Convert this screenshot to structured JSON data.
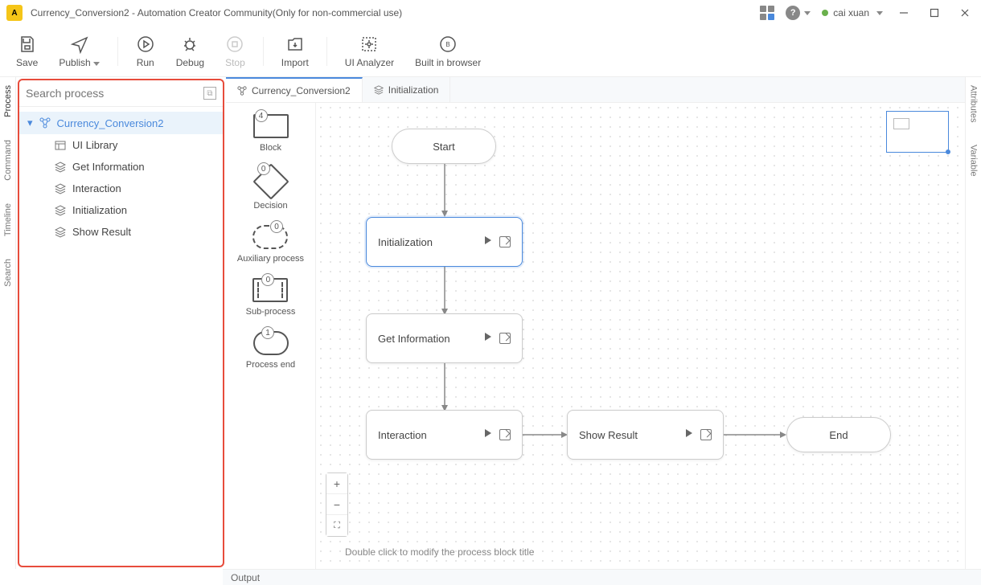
{
  "title": "Currency_Conversion2 - Automation Creator Community(Only for non-commercial use)",
  "user": "cai xuan",
  "toolbar": {
    "save": "Save",
    "publish": "Publish",
    "run": "Run",
    "debug": "Debug",
    "stop": "Stop",
    "import": "Import",
    "ui_analyzer": "UI Analyzer",
    "built_in_browser": "Built in browser"
  },
  "leftbar": [
    "Process",
    "Command",
    "Timeline",
    "Search"
  ],
  "rightbar": [
    "Attributes",
    "Variable"
  ],
  "search_placeholder": "Search process",
  "tree": {
    "root": "Currency_Conversion2",
    "children": [
      "UI Library",
      "Get Information",
      "Interaction",
      "Initialization",
      "Show Result"
    ]
  },
  "tabs": [
    {
      "label": "Currency_Conversion2",
      "active": true,
      "icon": "flow"
    },
    {
      "label": "Initialization",
      "active": false,
      "icon": "stack"
    }
  ],
  "palette": [
    {
      "label": "Block",
      "badge": "4",
      "shape": "rect"
    },
    {
      "label": "Decision",
      "badge": "0",
      "shape": "diamond"
    },
    {
      "label": "Auxiliary process",
      "badge": "0",
      "shape": "pill"
    },
    {
      "label": "Sub-process",
      "badge": "0",
      "shape": "sub"
    },
    {
      "label": "Process end",
      "badge": "1",
      "shape": "end"
    }
  ],
  "nodes": {
    "start": "Start",
    "initialization": "Initialization",
    "get_information": "Get Information",
    "interaction": "Interaction",
    "show_result": "Show Result",
    "end": "End"
  },
  "hint": "Double click to modify the process block title",
  "status": "Output"
}
